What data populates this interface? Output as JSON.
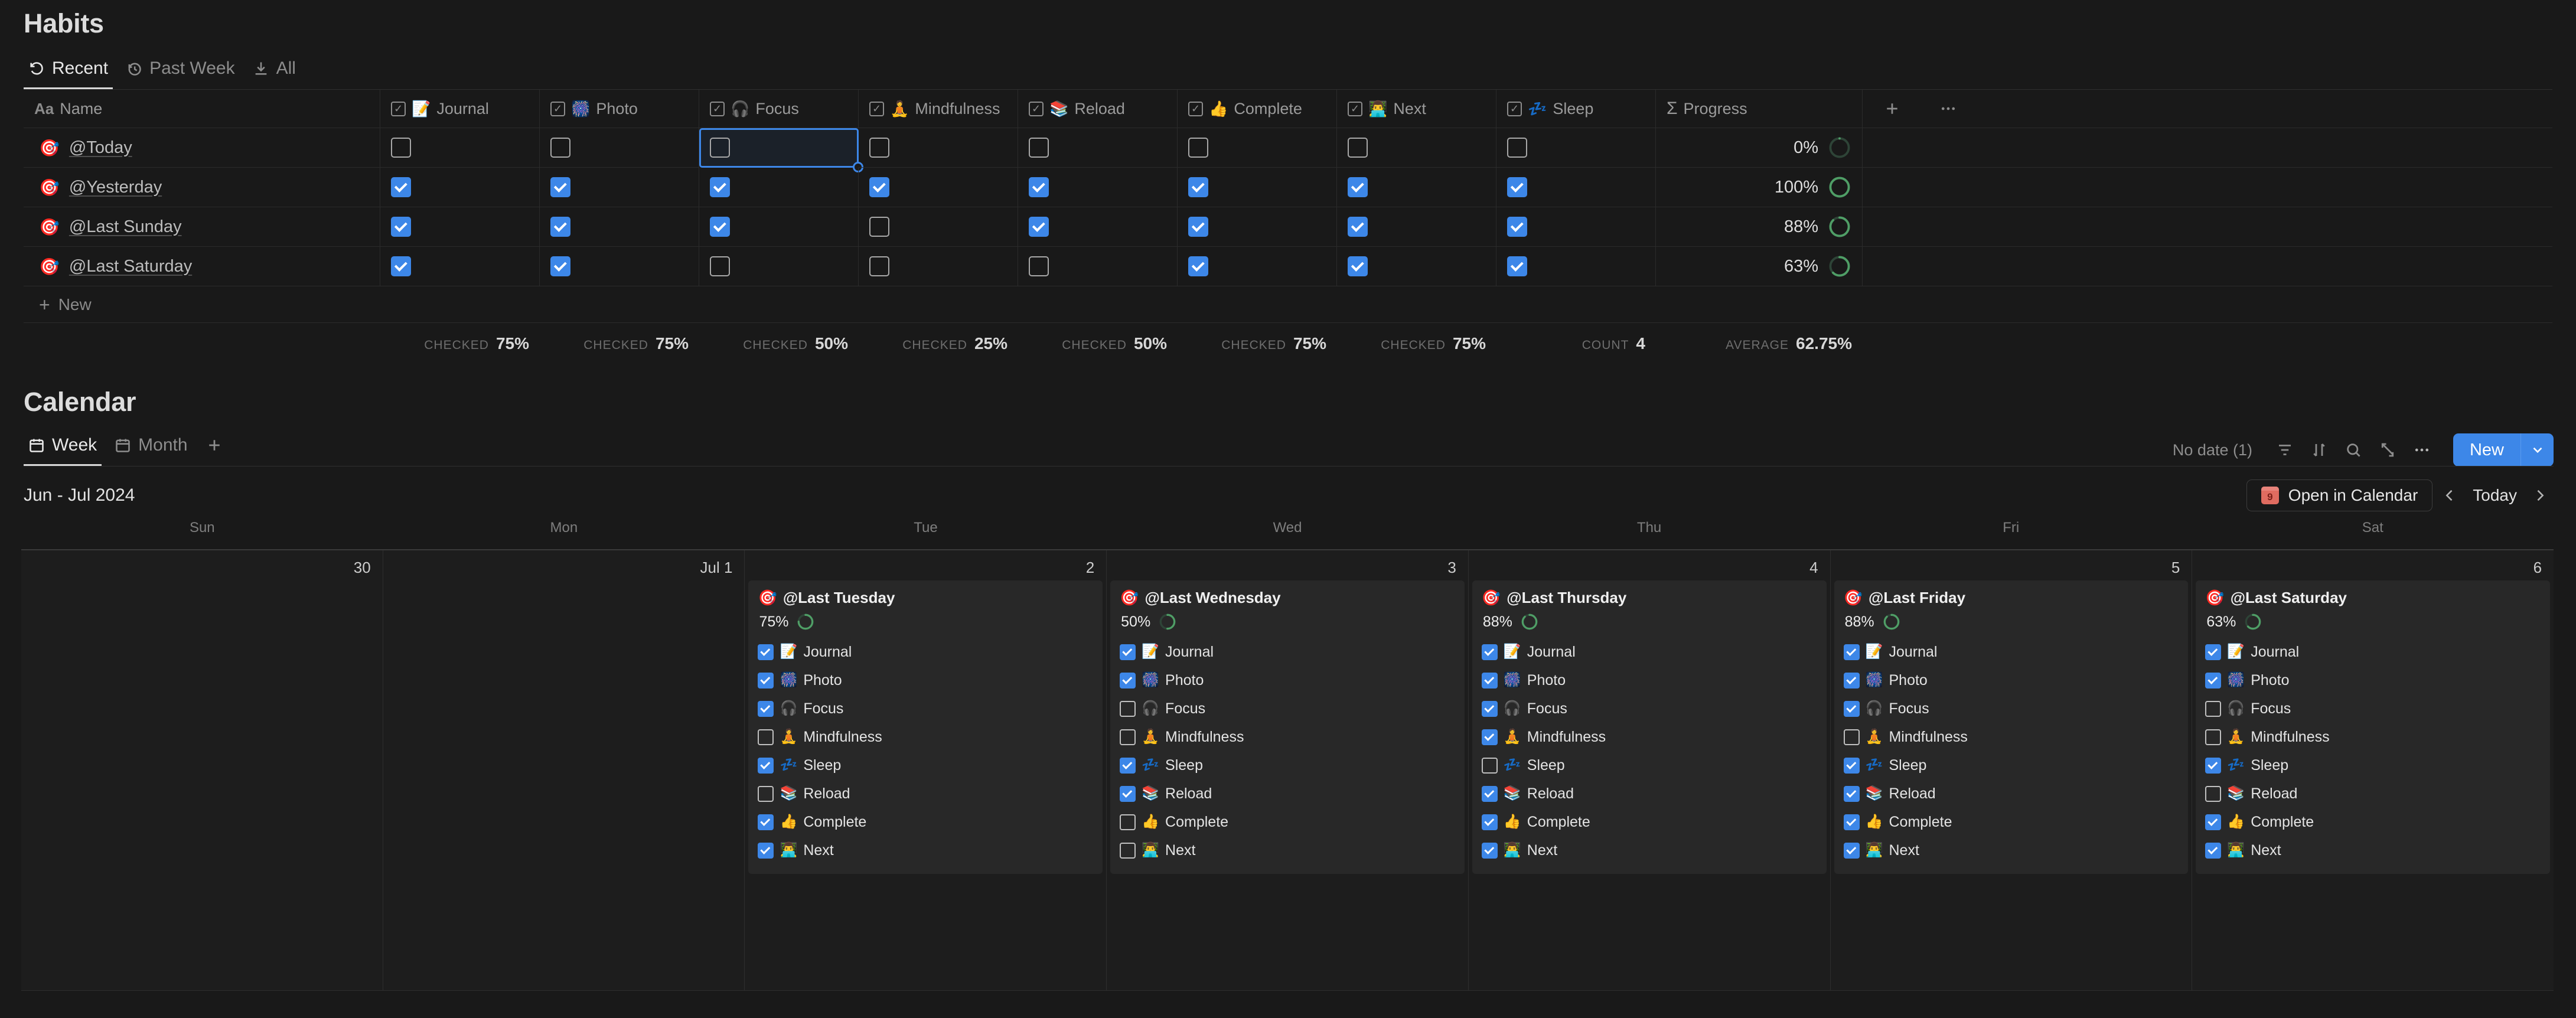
{
  "habits": {
    "title": "Habits",
    "view_tabs": [
      {
        "label": "Recent",
        "icon": "undo-icon",
        "active": true
      },
      {
        "label": "Past Week",
        "icon": "history-icon",
        "active": false
      },
      {
        "label": "All",
        "icon": "download-icon",
        "active": false
      }
    ],
    "columns": [
      {
        "key": "name",
        "label": "Name",
        "type": "title",
        "icon": "aa-icon"
      },
      {
        "key": "journal",
        "label": "Journal",
        "type": "checkbox",
        "emoji": "📝"
      },
      {
        "key": "photo",
        "label": "Photo",
        "type": "checkbox",
        "emoji": "🎆"
      },
      {
        "key": "focus",
        "label": "Focus",
        "type": "checkbox",
        "emoji": "🎧"
      },
      {
        "key": "mindfulness",
        "label": "Mindfulness",
        "type": "checkbox",
        "emoji": "🧘"
      },
      {
        "key": "reload",
        "label": "Reload",
        "type": "checkbox",
        "emoji": "📚"
      },
      {
        "key": "complete",
        "label": "Complete",
        "type": "checkbox",
        "emoji": "👍"
      },
      {
        "key": "next",
        "label": "Next",
        "type": "checkbox",
        "emoji": "👨‍💻"
      },
      {
        "key": "sleep",
        "label": "Sleep",
        "type": "checkbox",
        "emoji": "💤"
      },
      {
        "key": "progress",
        "label": "Progress",
        "type": "formula",
        "icon": "sigma-icon"
      }
    ],
    "add_column_label": "+",
    "more_columns_label": "•••",
    "rows": [
      {
        "name": "@Today",
        "journal": false,
        "photo": false,
        "focus": false,
        "mindfulness": false,
        "reload": false,
        "complete": false,
        "next": false,
        "sleep": false,
        "progress": "0%",
        "progress_pct": 0
      },
      {
        "name": "@Yesterday",
        "journal": true,
        "photo": true,
        "focus": true,
        "mindfulness": true,
        "reload": true,
        "complete": true,
        "next": true,
        "sleep": true,
        "progress": "100%",
        "progress_pct": 100
      },
      {
        "name": "@Last Sunday",
        "journal": true,
        "photo": true,
        "focus": true,
        "mindfulness": false,
        "reload": true,
        "complete": true,
        "next": true,
        "sleep": true,
        "progress": "88%",
        "progress_pct": 88
      },
      {
        "name": "@Last Saturday",
        "journal": true,
        "photo": true,
        "focus": false,
        "mindfulness": false,
        "reload": false,
        "complete": true,
        "next": true,
        "sleep": true,
        "progress": "63%",
        "progress_pct": 63
      }
    ],
    "selected_cell": {
      "row": 0,
      "column": "focus"
    },
    "new_row_label": "New",
    "aggregations": [
      {
        "column": "journal",
        "label": "CHECKED",
        "value": "75%"
      },
      {
        "column": "photo",
        "label": "CHECKED",
        "value": "75%"
      },
      {
        "column": "focus",
        "label": "CHECKED",
        "value": "50%"
      },
      {
        "column": "mindfulness",
        "label": "CHECKED",
        "value": "25%"
      },
      {
        "column": "reload",
        "label": "CHECKED",
        "value": "50%"
      },
      {
        "column": "complete",
        "label": "CHECKED",
        "value": "75%"
      },
      {
        "column": "next",
        "label": "CHECKED",
        "value": "75%"
      },
      {
        "column": "sleep",
        "label": "COUNT",
        "value": "4"
      },
      {
        "column": "progress",
        "label": "AVERAGE",
        "value": "62.75%"
      }
    ]
  },
  "calendar": {
    "title": "Calendar",
    "view_tabs": [
      {
        "label": "Week",
        "icon": "calendar-icon",
        "active": true
      },
      {
        "label": "Month",
        "icon": "calendar-icon",
        "active": false
      }
    ],
    "add_view_label": "+",
    "toolbar": {
      "no_date_label": "No date (1)",
      "filter_icon": "filter-icon",
      "sort_icon": "sort-icon",
      "search_icon": "search-icon",
      "expand_icon": "expand-icon",
      "more_icon": "more-icon",
      "new_label": "New",
      "new_caret_icon": "chevron-down-icon"
    },
    "date_range": "Jun - Jul 2024",
    "open_in_calendar_label": "Open in Calendar",
    "open_in_calendar_icon": "apple-calendar-icon",
    "prev_icon": "chevron-left-icon",
    "today_label": "Today",
    "next_icon": "chevron-right-icon",
    "day_headers": [
      "Sun",
      "Mon",
      "Tue",
      "Wed",
      "Thu",
      "Fri",
      "Sat"
    ],
    "days": [
      {
        "day_label": "Sun",
        "date_label": "30",
        "events": []
      },
      {
        "day_label": "Mon",
        "date_label": "Jul 1",
        "events": []
      },
      {
        "day_label": "Tue",
        "date_label": "2",
        "events": [
          {
            "title": "@Last Tuesday",
            "icon": "bullseye-icon",
            "progress": "75%",
            "progress_pct": 75,
            "items": [
              {
                "label": "Journal",
                "emoji": "📝",
                "checked": true
              },
              {
                "label": "Photo",
                "emoji": "🎆",
                "checked": true
              },
              {
                "label": "Focus",
                "emoji": "🎧",
                "checked": true
              },
              {
                "label": "Mindfulness",
                "emoji": "🧘",
                "checked": false
              },
              {
                "label": "Sleep",
                "emoji": "💤",
                "checked": true
              },
              {
                "label": "Reload",
                "emoji": "📚",
                "checked": false
              },
              {
                "label": "Complete",
                "emoji": "👍",
                "checked": true
              },
              {
                "label": "Next",
                "emoji": "👨‍💻",
                "checked": true
              }
            ]
          }
        ]
      },
      {
        "day_label": "Wed",
        "date_label": "3",
        "events": [
          {
            "title": "@Last Wednesday",
            "icon": "bullseye-icon",
            "progress": "50%",
            "progress_pct": 50,
            "items": [
              {
                "label": "Journal",
                "emoji": "📝",
                "checked": true
              },
              {
                "label": "Photo",
                "emoji": "🎆",
                "checked": true
              },
              {
                "label": "Focus",
                "emoji": "🎧",
                "checked": false
              },
              {
                "label": "Mindfulness",
                "emoji": "🧘",
                "checked": false
              },
              {
                "label": "Sleep",
                "emoji": "💤",
                "checked": true
              },
              {
                "label": "Reload",
                "emoji": "📚",
                "checked": true
              },
              {
                "label": "Complete",
                "emoji": "👍",
                "checked": false
              },
              {
                "label": "Next",
                "emoji": "👨‍💻",
                "checked": false
              }
            ]
          }
        ]
      },
      {
        "day_label": "Thu",
        "date_label": "4",
        "events": [
          {
            "title": "@Last Thursday",
            "icon": "bullseye-icon",
            "progress": "88%",
            "progress_pct": 88,
            "items": [
              {
                "label": "Journal",
                "emoji": "📝",
                "checked": true
              },
              {
                "label": "Photo",
                "emoji": "🎆",
                "checked": true
              },
              {
                "label": "Focus",
                "emoji": "🎧",
                "checked": true
              },
              {
                "label": "Mindfulness",
                "emoji": "🧘",
                "checked": true
              },
              {
                "label": "Sleep",
                "emoji": "💤",
                "checked": false
              },
              {
                "label": "Reload",
                "emoji": "📚",
                "checked": true
              },
              {
                "label": "Complete",
                "emoji": "👍",
                "checked": true
              },
              {
                "label": "Next",
                "emoji": "👨‍💻",
                "checked": true
              }
            ]
          }
        ]
      },
      {
        "day_label": "Fri",
        "date_label": "5",
        "events": [
          {
            "title": "@Last Friday",
            "icon": "bullseye-icon",
            "progress": "88%",
            "progress_pct": 88,
            "items": [
              {
                "label": "Journal",
                "emoji": "📝",
                "checked": true
              },
              {
                "label": "Photo",
                "emoji": "🎆",
                "checked": true
              },
              {
                "label": "Focus",
                "emoji": "🎧",
                "checked": true
              },
              {
                "label": "Mindfulness",
                "emoji": "🧘",
                "checked": false
              },
              {
                "label": "Sleep",
                "emoji": "💤",
                "checked": true
              },
              {
                "label": "Reload",
                "emoji": "📚",
                "checked": true
              },
              {
                "label": "Complete",
                "emoji": "👍",
                "checked": true
              },
              {
                "label": "Next",
                "emoji": "👨‍💻",
                "checked": true
              }
            ]
          }
        ]
      },
      {
        "day_label": "Sat",
        "date_label": "6",
        "events": [
          {
            "title": "@Last Saturday",
            "icon": "bullseye-icon",
            "progress": "63%",
            "progress_pct": 63,
            "items": [
              {
                "label": "Journal",
                "emoji": "📝",
                "checked": true
              },
              {
                "label": "Photo",
                "emoji": "🎆",
                "checked": true
              },
              {
                "label": "Focus",
                "emoji": "🎧",
                "checked": false
              },
              {
                "label": "Mindfulness",
                "emoji": "🧘",
                "checked": false
              },
              {
                "label": "Sleep",
                "emoji": "💤",
                "checked": true
              },
              {
                "label": "Reload",
                "emoji": "📚",
                "checked": false
              },
              {
                "label": "Complete",
                "emoji": "👍",
                "checked": true
              },
              {
                "label": "Next",
                "emoji": "👨‍💻",
                "checked": true
              }
            ]
          }
        ]
      }
    ]
  },
  "colors": {
    "background": "#191919",
    "accent_blue": "#3d87e8",
    "progress_green": "#4f9e66",
    "text_primary": "#dcdcdc",
    "text_muted": "#8d8d8d"
  }
}
